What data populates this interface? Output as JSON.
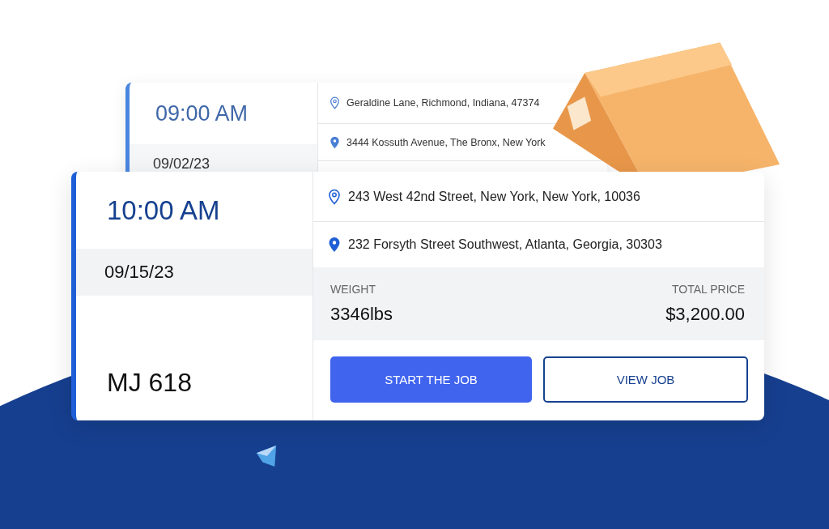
{
  "back_card": {
    "time": "09:00 AM",
    "date": "09/02/23",
    "stops": [
      {
        "kind": "pickup",
        "address": "Geraldine Lane, Richmond, Indiana, 47374"
      },
      {
        "kind": "dropoff",
        "address": "3444 Kossuth Avenue, The Bronx, New York"
      }
    ]
  },
  "job_card": {
    "time": "10:00 AM",
    "date": "09/15/23",
    "code": "MJ 618",
    "stops": [
      {
        "kind": "pickup",
        "address": "243 West 42nd Street, New York, New York, 10036"
      },
      {
        "kind": "dropoff",
        "address": "232 Forsyth Street Southwest, Atlanta, Georgia, 30303"
      }
    ],
    "weight_label": "WEIGHT",
    "weight": "3346lbs",
    "price_label": "TOTAL PRICE",
    "price": "$3,200.00",
    "buttons": [
      {
        "kind": "primary",
        "label": "START THE JOB"
      },
      {
        "kind": "outline",
        "label": "VIEW JOB"
      }
    ]
  }
}
